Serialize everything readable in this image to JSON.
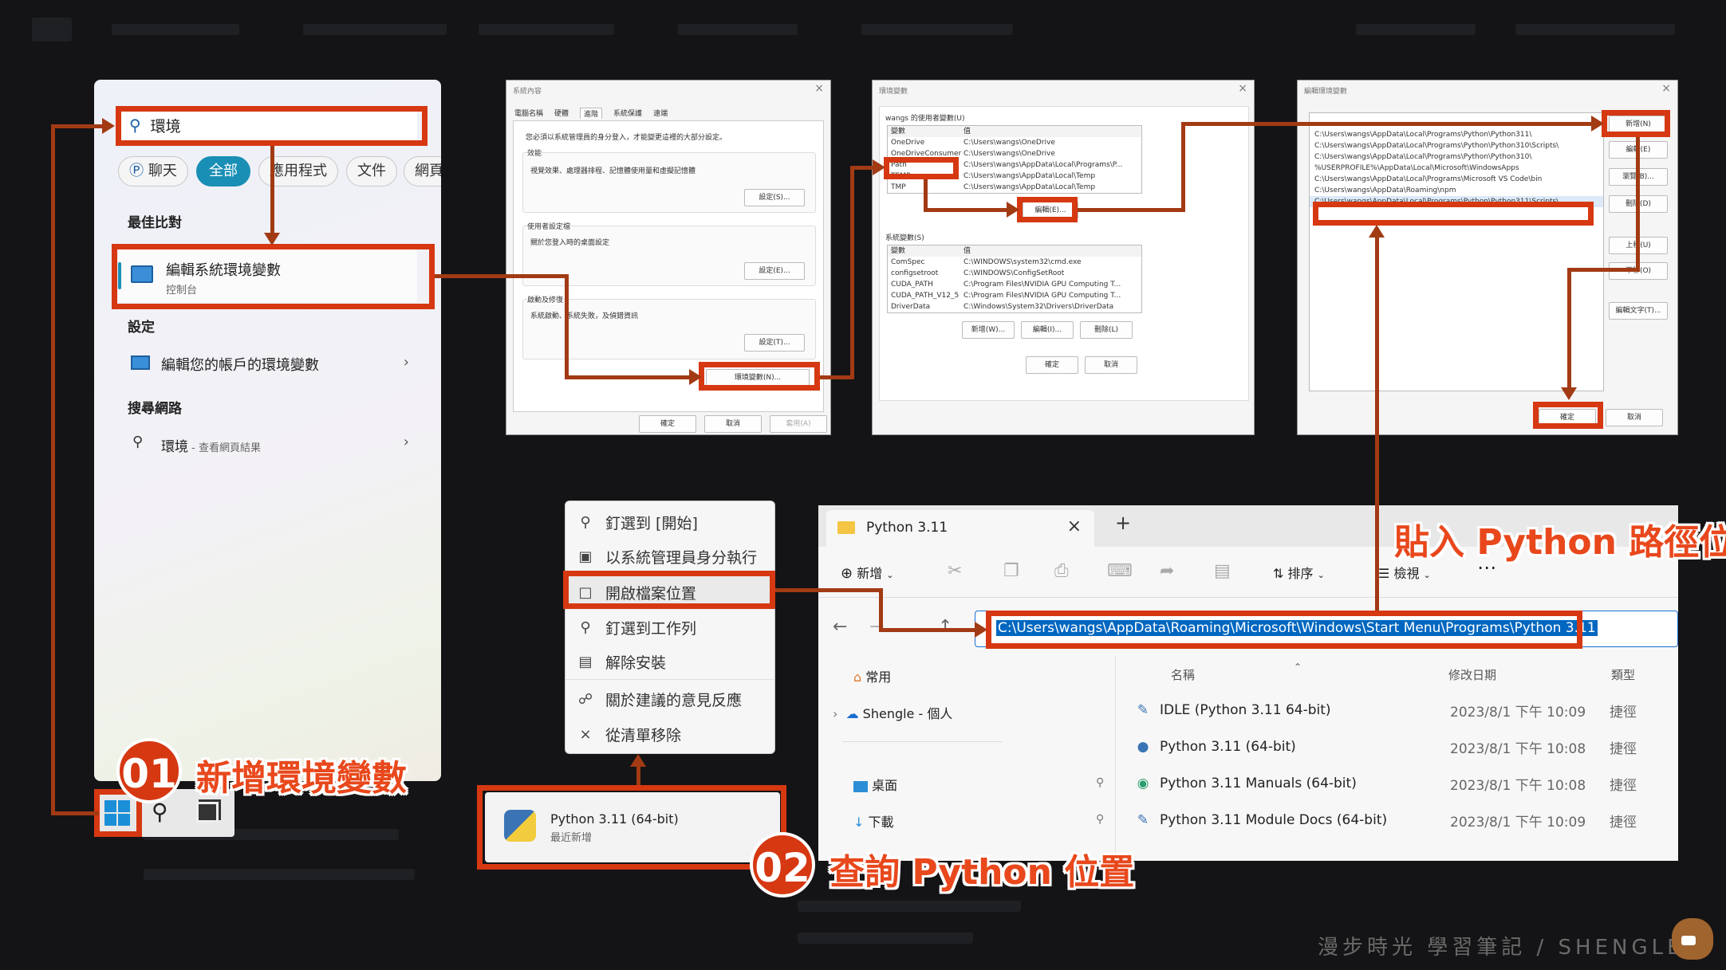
{
  "start_menu": {
    "search_value": "環境",
    "filters": [
      "聊天",
      "全部",
      "應用程式",
      "文件",
      "網頁"
    ],
    "best_match_heading": "最佳比對",
    "best_match_title": "編輯系統環境變數",
    "best_match_subtitle": "控制台",
    "settings_heading": "設定",
    "settings_item": "編輯您的帳戶的環境變數",
    "web_heading": "搜尋網路",
    "web_item": "環境",
    "web_item_sub": " - 查看網頁結果"
  },
  "sys_props": {
    "title": "系統內容",
    "tabs": [
      "電腦名稱",
      "硬體",
      "進階",
      "系統保護",
      "遠端"
    ],
    "note": "您必須以系統管理員的身分登入，才能變更這裡的大部分設定。",
    "perf_title": "效能",
    "perf_desc": "視覺效果、處理器排程、記憶體使用量和虛擬記憶體",
    "perf_btn": "設定(S)...",
    "profile_title": "使用者設定檔",
    "profile_desc": "關於您登入時的桌面設定",
    "profile_btn": "設定(E)...",
    "startup_title": "啟動及修復",
    "startup_desc": "系統啟動、系統失敗，及偵錯資訊",
    "startup_btn": "設定(T)...",
    "env_btn": "環境變數(N)...",
    "ok": "確定",
    "cancel": "取消",
    "apply": "套用(A)"
  },
  "env_vars": {
    "title": "環境變數",
    "user_title": "wangs 的使用者變數(U)",
    "col_var": "變數",
    "col_val": "值",
    "user_rows": [
      {
        "name": "OneDrive",
        "value": "C:\\Users\\wangs\\OneDrive"
      },
      {
        "name": "OneDriveConsumer",
        "value": "C:\\Users\\wangs\\OneDrive"
      },
      {
        "name": "Path",
        "value": "C:\\Users\\wangs\\AppData\\Local\\Programs\\P..."
      },
      {
        "name": "TEMP",
        "value": "C:\\Users\\wangs\\AppData\\Local\\Temp"
      },
      {
        "name": "TMP",
        "value": "C:\\Users\\wangs\\AppData\\Local\\Temp"
      }
    ],
    "user_edit": "編輯(E)...",
    "sys_title": "系統變數(S)",
    "sys_rows": [
      {
        "name": "ComSpec",
        "value": "C:\\WINDOWS\\system32\\cmd.exe"
      },
      {
        "name": "configsetroot",
        "value": "C:\\WINDOWS\\ConfigSetRoot"
      },
      {
        "name": "CUDA_PATH",
        "value": "C:\\Program Files\\NVIDIA GPU Computing T..."
      },
      {
        "name": "CUDA_PATH_V12_5",
        "value": "C:\\Program Files\\NVIDIA GPU Computing T..."
      },
      {
        "name": "DriverData",
        "value": "C:\\Windows\\System32\\Drivers\\DriverData"
      }
    ],
    "sys_new": "新增(W)...",
    "sys_edit": "編輯(I)...",
    "sys_delete": "刪除(L)",
    "ok": "確定",
    "cancel": "取消"
  },
  "edit_env": {
    "title": "編輯環境變數",
    "rows": [
      "C:\\Users\\wangs\\AppData\\Local\\Programs\\Python\\Python311\\",
      "C:\\Users\\wangs\\AppData\\Local\\Programs\\Python\\Python310\\Scripts\\",
      "C:\\Users\\wangs\\AppData\\Local\\Programs\\Python\\Python310\\",
      "%USERPROFILE%\\AppData\\Local\\Microsoft\\WindowsApps",
      "C:\\Users\\wangs\\AppData\\Local\\Programs\\Microsoft VS Code\\bin",
      "C:\\Users\\wangs\\AppData\\Roaming\\npm",
      "C:\\Users\\wangs\\AppData\\Local\\Programs\\Python\\Python311\\Scripts\\"
    ],
    "buttons": [
      "新增(N)",
      "編輯(E)",
      "瀏覽(B)...",
      "刪除(D)",
      "上移(U)",
      "下移(O)",
      "編輯文字(T)..."
    ],
    "ok": "確定",
    "cancel": "取消"
  },
  "context_menu": {
    "items": [
      "釘選到 [開始]",
      "以系統管理員身分執行",
      "開啟檔案位置",
      "釘選到工作列",
      "解除安裝",
      "關於建議的意見反應",
      "從清單移除"
    ]
  },
  "taskbar_item": {
    "title": "Python 3.11 (64-bit)",
    "subtitle": "最近新增"
  },
  "explorer": {
    "tab_title": "Python 3.11",
    "toolbar_new": "新增",
    "toolbar_sort": "排序",
    "toolbar_view": "檢視",
    "address": "C:\\Users\\wangs\\AppData\\Roaming\\Microsoft\\Windows\\Start Menu\\Programs\\Python 3.11",
    "nav": [
      "常用",
      "Shengle - 個人",
      "桌面",
      "下載"
    ],
    "col_name": "名稱",
    "col_date": "修改日期",
    "col_type": "類型",
    "files": [
      {
        "name": "IDLE (Python 3.11 64-bit)",
        "date": "2023/8/1 下午 10:09",
        "type": "捷徑"
      },
      {
        "name": "Python 3.11 (64-bit)",
        "date": "2023/8/1 下午 10:08",
        "type": "捷徑"
      },
      {
        "name": "Python 3.11 Manuals (64-bit)",
        "date": "2023/8/1 下午 10:08",
        "type": "捷徑"
      },
      {
        "name": "Python 3.11 Module Docs (64-bit)",
        "date": "2023/8/1 下午 10:09",
        "type": "捷徑"
      }
    ]
  },
  "annotations": {
    "step1_num": "01",
    "step1_text": "新增環境變數",
    "step2_num": "02",
    "step2_text": "查詢 Python 位置",
    "paste_text": "貼入 Python 路徑位置"
  },
  "watermark": "漫步時光 學習筆記 / SHENGLE",
  "colors": {
    "highlight": "#d63812",
    "connector": "#a23a14",
    "accent": "#1a8fb5"
  }
}
